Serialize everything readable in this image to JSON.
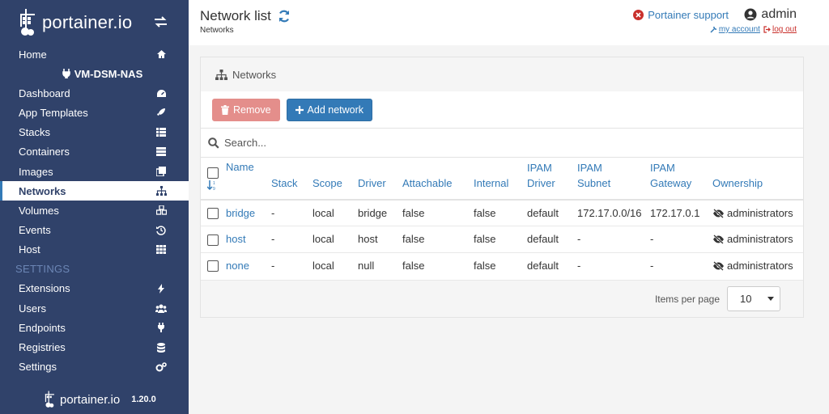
{
  "brand": {
    "name": "portainer.io",
    "version": "1.20.0"
  },
  "sidebar": {
    "home": "Home",
    "endpoint": "VM-DSM-NAS",
    "items": [
      {
        "label": "Dashboard",
        "icon": "tachometer-icon"
      },
      {
        "label": "App Templates",
        "icon": "rocket-icon"
      },
      {
        "label": "Stacks",
        "icon": "th-list-icon"
      },
      {
        "label": "Containers",
        "icon": "server-icon"
      },
      {
        "label": "Images",
        "icon": "clone-icon"
      },
      {
        "label": "Networks",
        "icon": "sitemap-icon",
        "active": true
      },
      {
        "label": "Volumes",
        "icon": "cubes-icon"
      },
      {
        "label": "Events",
        "icon": "history-icon"
      },
      {
        "label": "Host",
        "icon": "th-icon"
      }
    ],
    "settings_title": "SETTINGS",
    "settings_items": [
      {
        "label": "Extensions",
        "icon": "bolt-icon"
      },
      {
        "label": "Users",
        "icon": "users-icon"
      },
      {
        "label": "Endpoints",
        "icon": "plug-icon"
      },
      {
        "label": "Registries",
        "icon": "database-icon"
      },
      {
        "label": "Settings",
        "icon": "cogs-icon"
      }
    ]
  },
  "header": {
    "title": "Network list",
    "breadcrumb": "Networks",
    "support": "Portainer support",
    "user": "admin",
    "my_account": "my account",
    "logout": "log out"
  },
  "panel": {
    "title": "Networks",
    "remove_label": "Remove",
    "add_label": "Add network",
    "search_placeholder": "Search...",
    "columns": {
      "name": "Name",
      "stack": "Stack",
      "scope": "Scope",
      "driver": "Driver",
      "attachable": "Attachable",
      "internal": "Internal",
      "ipam_driver_1": "IPAM",
      "ipam_driver_2": "Driver",
      "ipam_subnet_1": "IPAM",
      "ipam_subnet_2": "Subnet",
      "ipam_gateway_1": "IPAM",
      "ipam_gateway_2": "Gateway",
      "ownership": "Ownership"
    },
    "rows": [
      {
        "name": "bridge",
        "stack": "-",
        "scope": "local",
        "driver": "bridge",
        "attachable": "false",
        "internal": "false",
        "ipam_driver": "default",
        "ipam_subnet": "172.17.0.0/16",
        "ipam_gateway": "172.17.0.1",
        "ownership": "administrators"
      },
      {
        "name": "host",
        "stack": "-",
        "scope": "local",
        "driver": "host",
        "attachable": "false",
        "internal": "false",
        "ipam_driver": "default",
        "ipam_subnet": "-",
        "ipam_gateway": "-",
        "ownership": "administrators"
      },
      {
        "name": "none",
        "stack": "-",
        "scope": "local",
        "driver": "null",
        "attachable": "false",
        "internal": "false",
        "ipam_driver": "default",
        "ipam_subnet": "-",
        "ipam_gateway": "-",
        "ownership": "administrators"
      }
    ],
    "items_per_page_label": "Items per page",
    "items_per_page_value": "10"
  },
  "colors": {
    "sidebar": "#30426a",
    "accent": "#337ab7",
    "danger": "#e48e8b"
  }
}
